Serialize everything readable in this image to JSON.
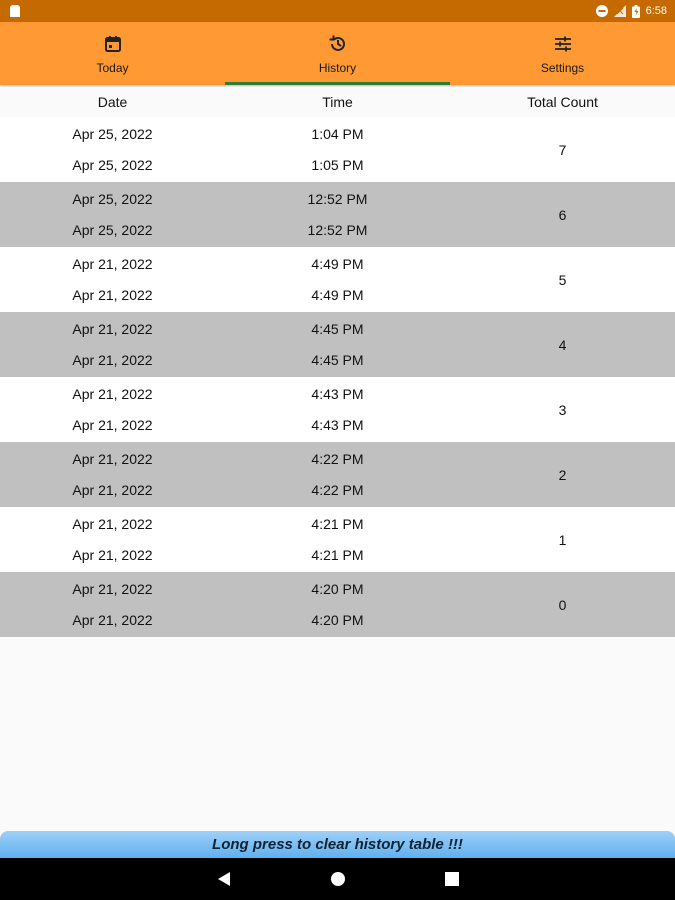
{
  "status_bar": {
    "time": "6:58",
    "icons": [
      "sim-card-icon",
      "dnd-icon",
      "signal-icon",
      "battery-icon"
    ]
  },
  "tabs": [
    {
      "label": "Today",
      "icon": "calendar-icon",
      "active": false
    },
    {
      "label": "History",
      "icon": "history-icon",
      "active": true
    },
    {
      "label": "Settings",
      "icon": "sliders-icon",
      "active": false
    }
  ],
  "table": {
    "headers": {
      "date": "Date",
      "time": "Time",
      "count": "Total Count"
    },
    "groups": [
      {
        "rows": [
          {
            "date": "Apr 25, 2022",
            "time": "1:04 PM"
          },
          {
            "date": "Apr 25, 2022",
            "time": "1:05 PM"
          }
        ],
        "count": "7"
      },
      {
        "rows": [
          {
            "date": "Apr 25, 2022",
            "time": "12:52 PM"
          },
          {
            "date": "Apr 25, 2022",
            "time": "12:52 PM"
          }
        ],
        "count": "6"
      },
      {
        "rows": [
          {
            "date": "Apr 21, 2022",
            "time": "4:49 PM"
          },
          {
            "date": "Apr 21, 2022",
            "time": "4:49 PM"
          }
        ],
        "count": "5"
      },
      {
        "rows": [
          {
            "date": "Apr 21, 2022",
            "time": "4:45 PM"
          },
          {
            "date": "Apr 21, 2022",
            "time": "4:45 PM"
          }
        ],
        "count": "4"
      },
      {
        "rows": [
          {
            "date": "Apr 21, 2022",
            "time": "4:43 PM"
          },
          {
            "date": "Apr 21, 2022",
            "time": "4:43 PM"
          }
        ],
        "count": "3"
      },
      {
        "rows": [
          {
            "date": "Apr 21, 2022",
            "time": "4:22 PM"
          },
          {
            "date": "Apr 21, 2022",
            "time": "4:22 PM"
          }
        ],
        "count": "2"
      },
      {
        "rows": [
          {
            "date": "Apr 21, 2022",
            "time": "4:21 PM"
          },
          {
            "date": "Apr 21, 2022",
            "time": "4:21 PM"
          }
        ],
        "count": "1"
      },
      {
        "rows": [
          {
            "date": "Apr 21, 2022",
            "time": "4:20 PM"
          },
          {
            "date": "Apr 21, 2022",
            "time": "4:20 PM"
          }
        ],
        "count": "0"
      }
    ]
  },
  "footer": {
    "clear_label": "Long press to clear history table !!!"
  },
  "colors": {
    "status_bar": "#c46a00",
    "tab_bar": "#ff9933",
    "active_indicator": "#2e7d32",
    "row_alt": "#c0c0c0"
  }
}
